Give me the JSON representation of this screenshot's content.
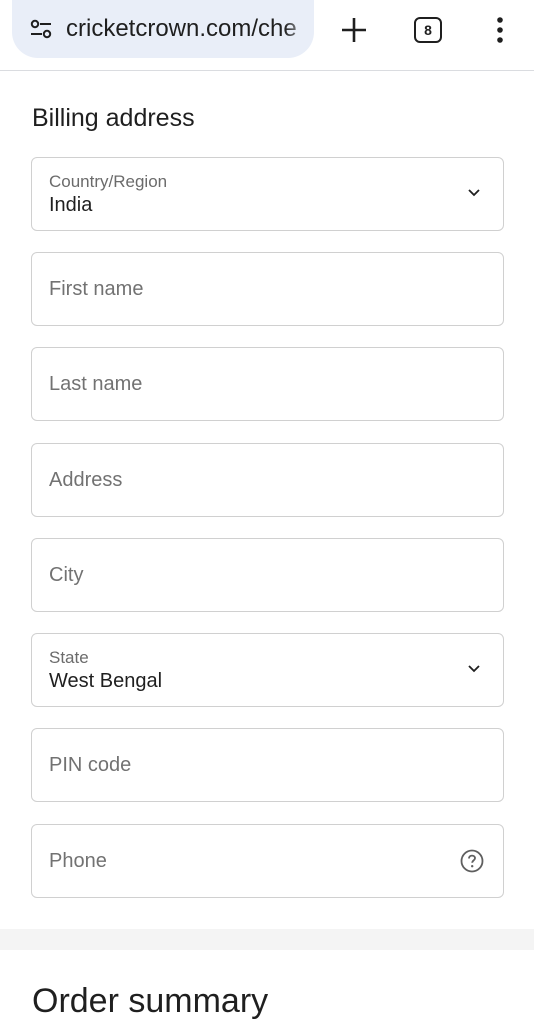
{
  "browser": {
    "url": "cricketcrown.com/che",
    "tab_count": "8",
    "icons": {
      "site_info": "tune-icon",
      "new_tab": "plus-icon",
      "tabs": "tab-switcher-icon",
      "menu": "more-vert-icon"
    }
  },
  "billing": {
    "heading": "Billing address",
    "country": {
      "label": "Country/Region",
      "value": "India"
    },
    "first_name": {
      "placeholder": "First name"
    },
    "last_name": {
      "placeholder": "Last name"
    },
    "address": {
      "placeholder": "Address"
    },
    "city": {
      "placeholder": "City"
    },
    "state": {
      "label": "State",
      "value": "West Bengal"
    },
    "pin": {
      "placeholder": "PIN code"
    },
    "phone": {
      "placeholder": "Phone"
    }
  },
  "summary": {
    "heading": "Order summary"
  },
  "colors": {
    "url_pill_bg": "#e9eef8",
    "border": "#d0d0d0",
    "text": "#1f1f1f",
    "muted": "#727272"
  }
}
